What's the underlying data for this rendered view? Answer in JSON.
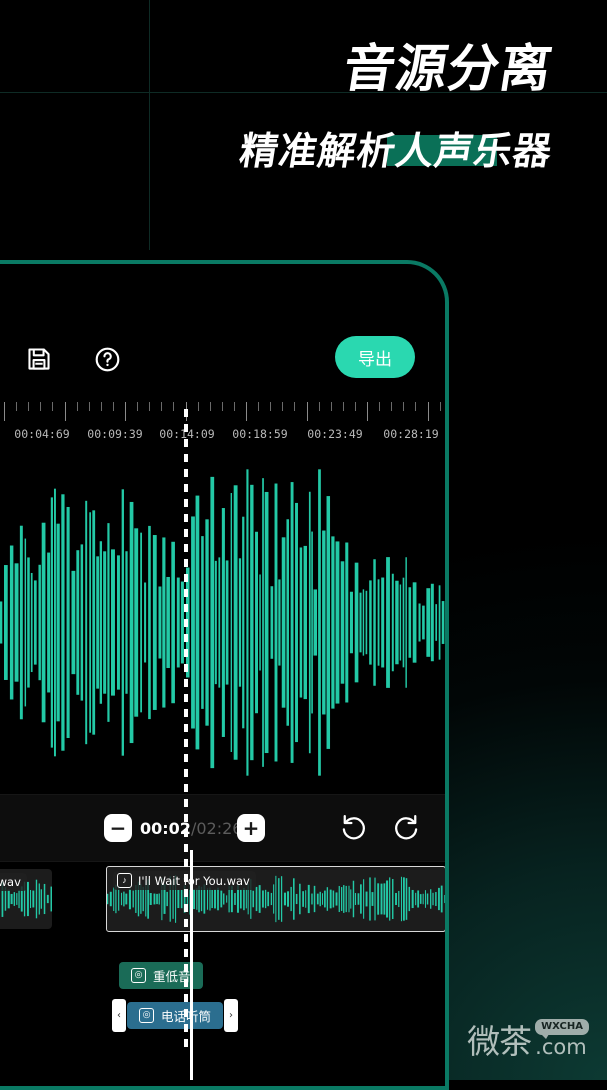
{
  "headline": {
    "line1": "音源分离",
    "line2": "精准解析人声乐器",
    "accent_color": "#0a7057"
  },
  "theme": {
    "accent": "#2ad8b0",
    "panel_border": "#0a7a64",
    "waveform": "#23c9a6",
    "background": "#000000"
  },
  "toolbar": {
    "save_icon": "save-icon",
    "help_icon": "help-icon",
    "export_label": "导出"
  },
  "ruler": {
    "labels": [
      "00:04:69",
      "00:09:39",
      "00:14:09",
      "00:18:59",
      "00:23:49",
      "00:28:19"
    ],
    "label_positions": [
      48,
      121,
      193,
      266,
      341,
      417
    ]
  },
  "transport": {
    "minus_label": "−",
    "plus_label": "+",
    "current_time": "00:02",
    "separator": "/",
    "total_time": "02:26",
    "undo_icon": "undo-icon",
    "redo_icon": "redo-icon"
  },
  "tracks": [
    {
      "name": "I'll Wait.wav",
      "has_note_icon": false
    },
    {
      "name": "I'll Wait for You.wav",
      "has_note_icon": true,
      "note_glyph": "♪"
    }
  ],
  "effects": [
    {
      "label": "重低音",
      "color": "#1a6b57",
      "selected": false,
      "icon": "speaker-icon"
    },
    {
      "label": "电话听筒",
      "color": "#2b6e8f",
      "selected": true,
      "icon": "speaker-icon"
    }
  ],
  "handles": {
    "left_chevron": "‹",
    "right_chevron": "›"
  },
  "watermark": {
    "cn": "微茶",
    "badge": "WXCHA",
    "domain": ".com"
  }
}
